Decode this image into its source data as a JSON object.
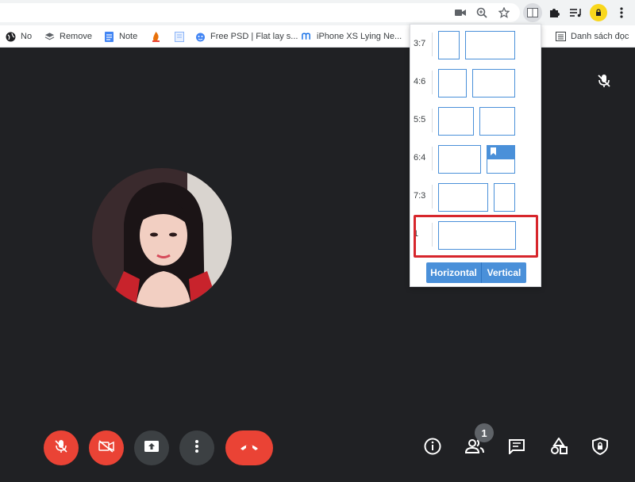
{
  "bookmarks": {
    "items": [
      {
        "label": "No",
        "icon": "globe-icon"
      },
      {
        "label": "Remove",
        "icon": "stack-icon"
      },
      {
        "label": "Note",
        "icon": "docs-icon"
      },
      {
        "label": "",
        "icon": "flame-icon"
      },
      {
        "label": "",
        "icon": "file-icon"
      },
      {
        "label": "Free PSD | Flat lay s...",
        "icon": "face-icon"
      },
      {
        "label": "iPhone XS Lying Ne...",
        "icon": "m-icon"
      },
      {
        "label": "Danh sách đọc",
        "icon": "reading-list-icon"
      }
    ]
  },
  "popup": {
    "rows": [
      {
        "ratio": "3:7"
      },
      {
        "ratio": "4:6"
      },
      {
        "ratio": "5:5"
      },
      {
        "ratio": "6:4"
      },
      {
        "ratio": "7:3"
      },
      {
        "ratio": "1"
      }
    ],
    "horizontal_label": "Horizontal",
    "vertical_label": "Vertical",
    "highlight_color": "#d7262c",
    "accent_color": "#4a90d9"
  },
  "controls": {
    "participants_count": "1",
    "red_color": "#ea4335"
  }
}
